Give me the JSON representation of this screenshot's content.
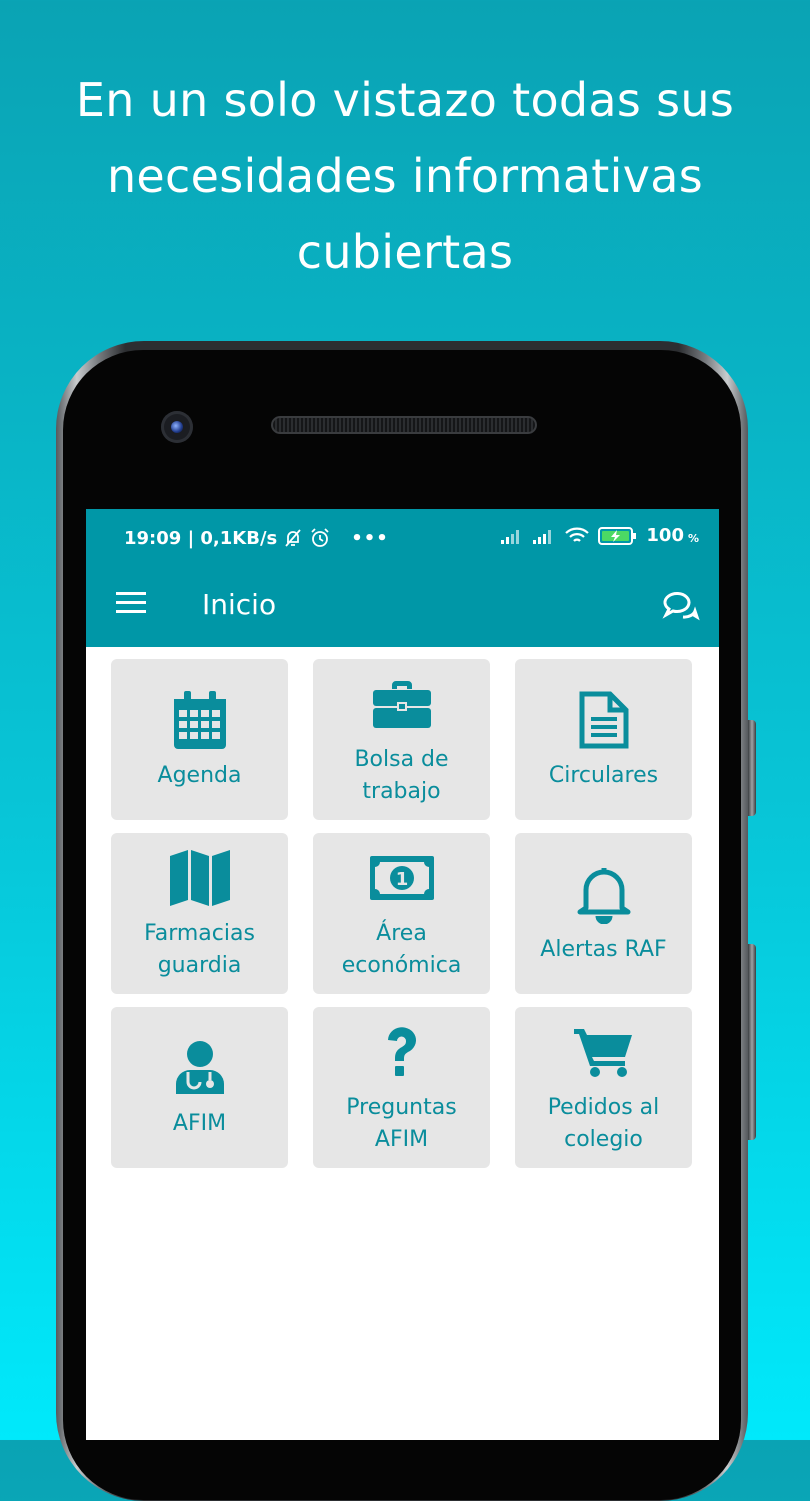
{
  "headline": {
    "line1": "En un solo vistazo todas sus",
    "line2": "necesidades informativas",
    "line3": "cubiertas"
  },
  "status_bar": {
    "time_speed": "19:09 | 0,1KB/s",
    "overflow": "•••",
    "battery_level": "100",
    "battery_unit": "%"
  },
  "app_bar": {
    "title": "Inicio"
  },
  "tiles": [
    {
      "label": "Agenda",
      "icon": "calendar-icon"
    },
    {
      "label": "Bolsa de\ntrabajo",
      "icon": "briefcase-icon"
    },
    {
      "label": "Circulares",
      "icon": "document-icon"
    },
    {
      "label": "Farmacias\nguardia",
      "icon": "map-icon"
    },
    {
      "label": "Área\neconómica",
      "icon": "money-icon"
    },
    {
      "label": "Alertas RAF",
      "icon": "bell-icon"
    },
    {
      "label": "AFIM",
      "icon": "doctor-icon"
    },
    {
      "label": "Preguntas\nAFIM",
      "icon": "question-icon"
    },
    {
      "label": "Pedidos al\ncolegio",
      "icon": "cart-icon"
    }
  ],
  "colors": {
    "accent": "#0097a7",
    "tile_background": "#e6e6e6",
    "tile_text": "#0a8d9c"
  }
}
